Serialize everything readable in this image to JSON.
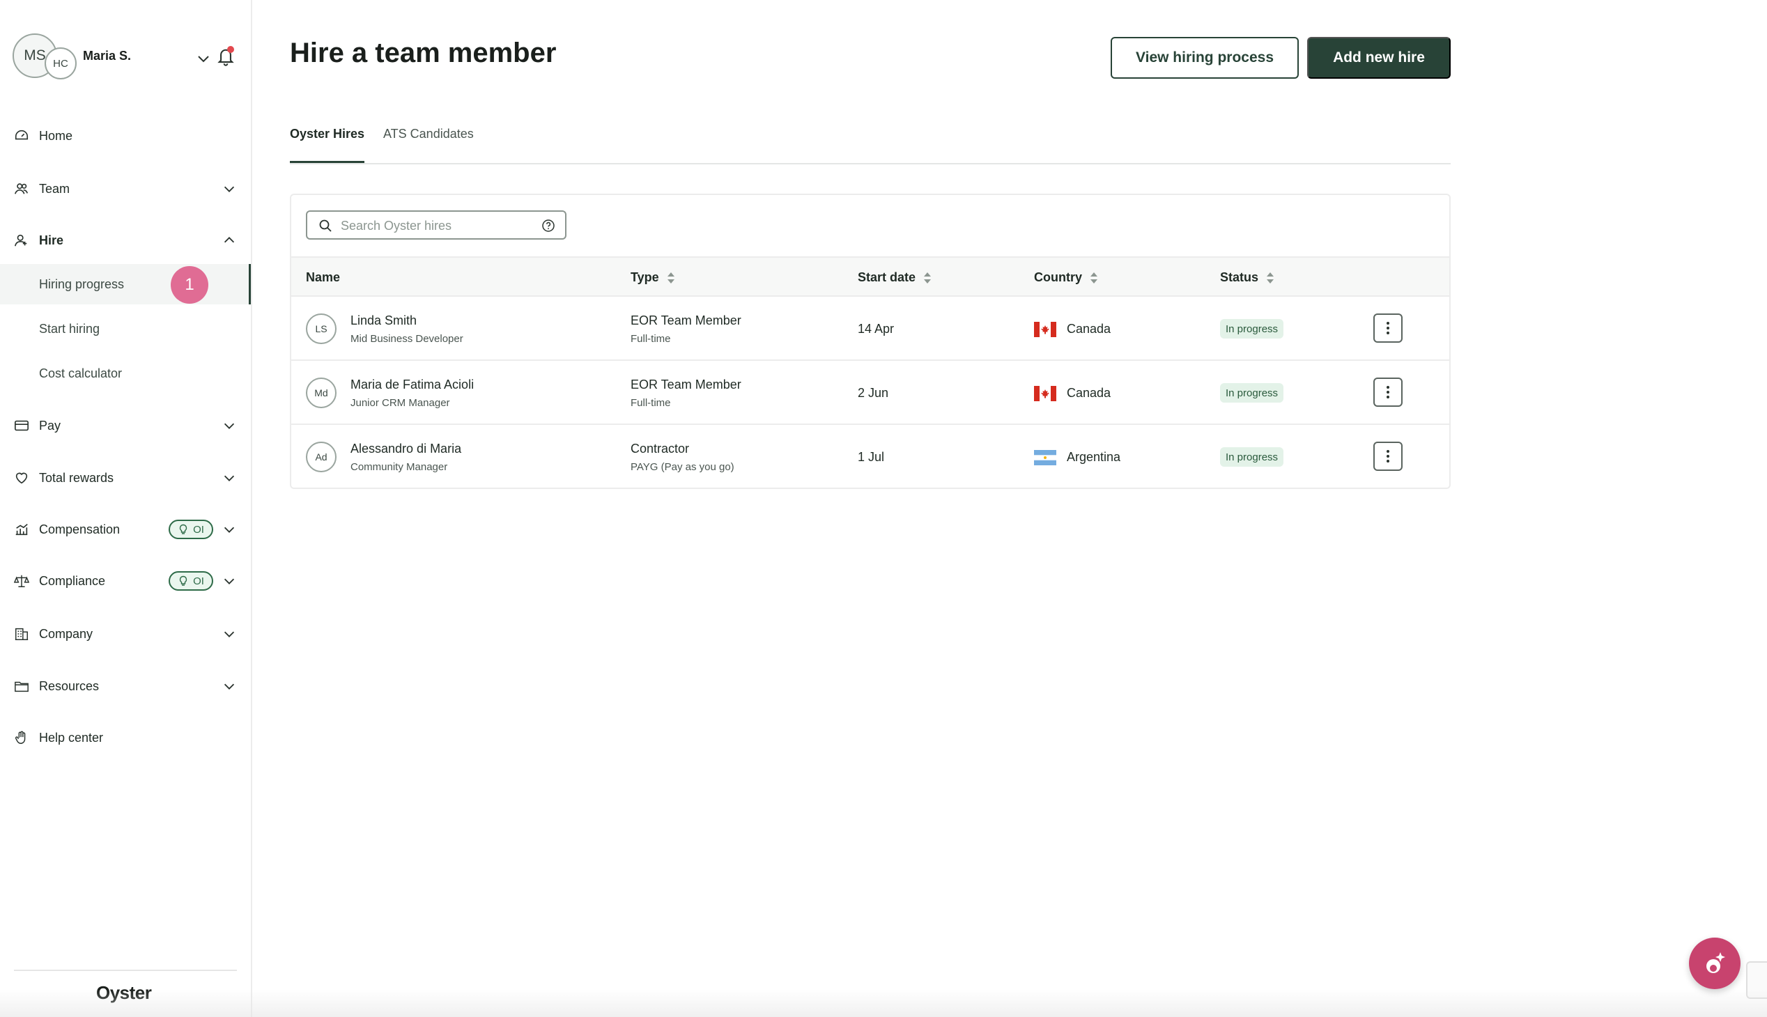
{
  "user": {
    "initials": "MS",
    "company_initials": "HC",
    "name": "Maria S."
  },
  "sidebar": {
    "items": [
      {
        "label": "Home",
        "icon": "home-icon"
      },
      {
        "label": "Team",
        "icon": "team-icon"
      },
      {
        "label": "Hire",
        "icon": "hire-icon"
      },
      {
        "label": "Pay",
        "icon": "pay-icon"
      },
      {
        "label": "Total rewards",
        "icon": "heart-icon"
      },
      {
        "label": "Compensation",
        "icon": "chart-icon",
        "badge": "OI"
      },
      {
        "label": "Compliance",
        "icon": "scales-icon",
        "badge": "OI"
      },
      {
        "label": "Company",
        "icon": "building-icon"
      },
      {
        "label": "Resources",
        "icon": "folder-icon"
      },
      {
        "label": "Help center",
        "icon": "hand-icon"
      }
    ],
    "hire_sub": [
      {
        "label": "Hiring progress",
        "badge": "1"
      },
      {
        "label": "Start hiring"
      },
      {
        "label": "Cost calculator"
      }
    ],
    "logo": "Oyster"
  },
  "header": {
    "title": "Hire a team member",
    "view_button": "View hiring process",
    "add_button": "Add new hire"
  },
  "tabs": [
    {
      "label": "Oyster Hires"
    },
    {
      "label": "ATS Candidates"
    }
  ],
  "search": {
    "placeholder": "Search Oyster hires"
  },
  "table": {
    "columns": [
      "Name",
      "Type",
      "Start date",
      "Country",
      "Status"
    ],
    "rows": [
      {
        "initials": "LS",
        "name": "Linda Smith",
        "role": "Mid Business Developer",
        "type": "EOR Team Member",
        "subtype": "Full-time",
        "start": "14 Apr",
        "country": "Canada",
        "flag": "canada-flag-icon",
        "status": "In progress"
      },
      {
        "initials": "Md",
        "name": "Maria de Fatima Acioli",
        "role": "Junior CRM Manager",
        "type": "EOR Team Member",
        "subtype": "Full-time",
        "start": "2 Jun",
        "country": "Canada",
        "flag": "canada-flag-icon",
        "status": "In progress"
      },
      {
        "initials": "Ad",
        "name": "Alessandro di Maria",
        "role": "Community Manager",
        "type": "Contractor",
        "subtype": "PAYG (Pay as you go)",
        "start": "1 Jul",
        "country": "Argentina",
        "flag": "argentina-flag-icon",
        "status": "In progress"
      }
    ]
  },
  "colors": {
    "brand": "#284337",
    "step_badge": "#e06c94",
    "status_bg": "#e3f2e8",
    "assistant": "#c8436e"
  }
}
